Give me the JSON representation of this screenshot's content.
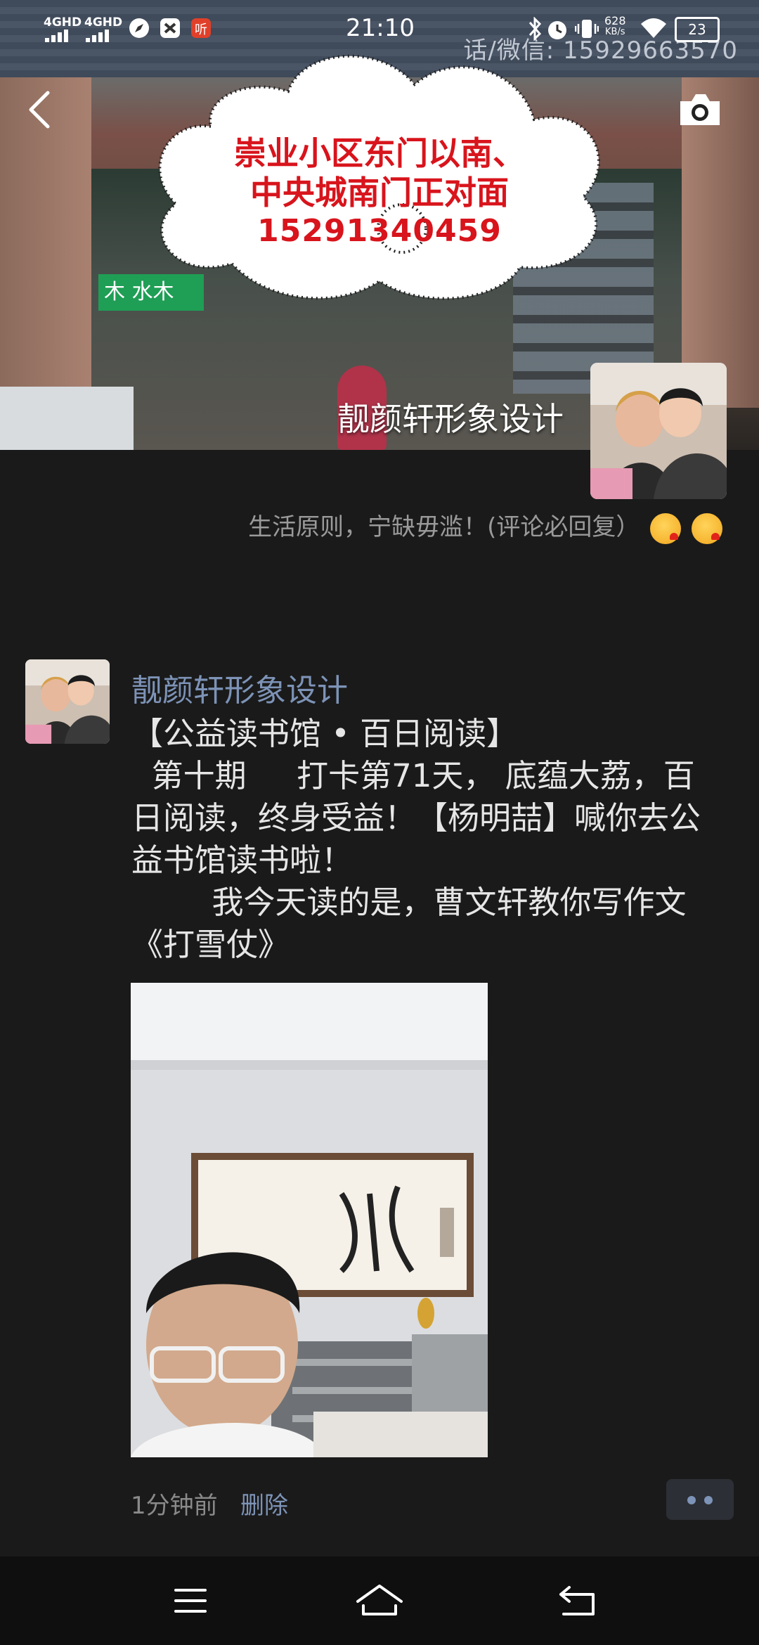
{
  "status_bar": {
    "network1": "4GHD",
    "network2": "4GHD",
    "time": "21:10",
    "speed_value": "628",
    "speed_unit": "KB/s",
    "battery": "23"
  },
  "cover": {
    "sign_text": "话/微信: 15929663570",
    "bubble_line1": "崇业小区东门以南、",
    "bubble_line2": "中央城南门正对面",
    "bubble_line3": "15291340459",
    "green_sign": "木 水木"
  },
  "profile": {
    "name": "靓颜轩形象设计",
    "signature": "生活原则，宁缺毋滥！(评论必回复）"
  },
  "post": {
    "author": "靓颜轩形象设计",
    "text": "【公益读书馆 • 百日阅读】\n  第十期     打卡第71天， 底蕴大荔，百日阅读，终身受益！【杨明喆】喊你去公益书馆读书啦！\n        我今天读的是，曹文轩教你写作文《打雪仗》",
    "time": "1分钟前",
    "delete_label": "删除"
  },
  "icons": {
    "back": "back-arrow-icon",
    "camera": "camera-icon",
    "more": "more-dots-icon",
    "menu": "menu-icon",
    "home": "home-icon",
    "return": "return-icon"
  }
}
